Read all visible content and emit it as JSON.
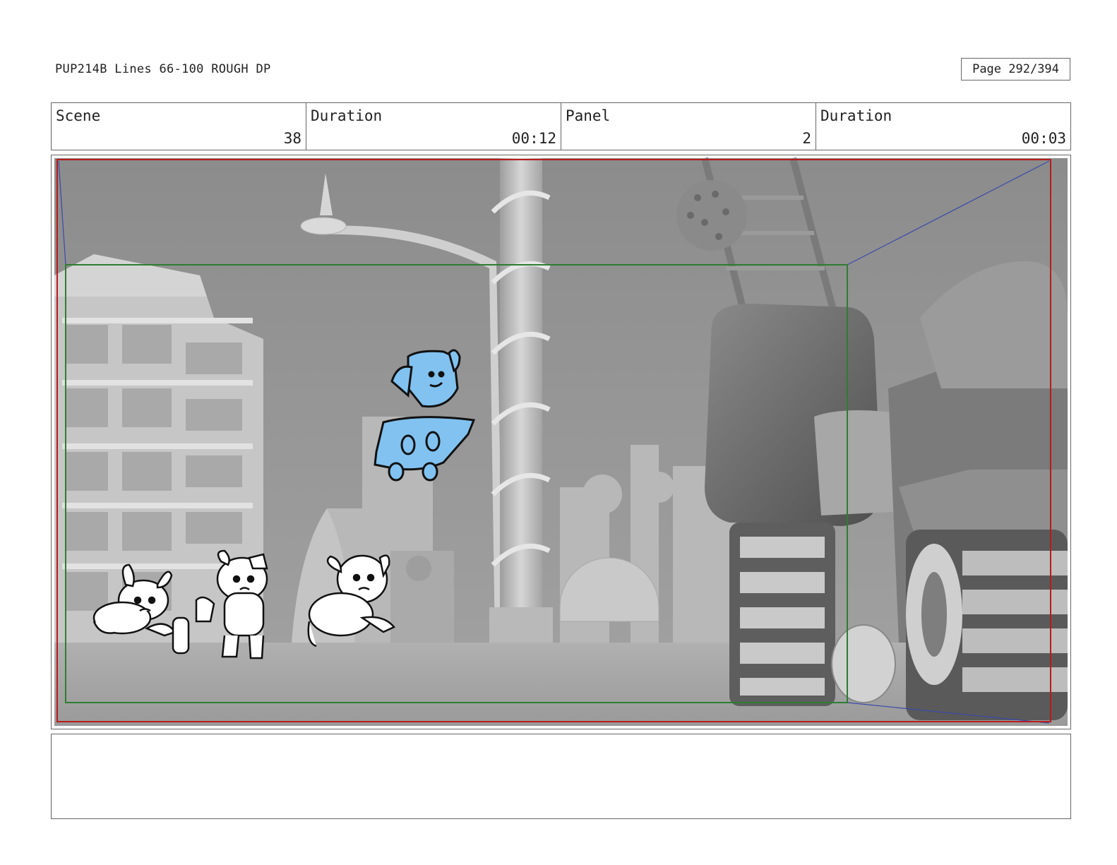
{
  "header": {
    "doc_title": "PUP214B Lines 66-100 ROUGH DP",
    "page_label": "Page 292/394"
  },
  "info": {
    "scene_label": "Scene",
    "scene_value": "38",
    "scene_duration_label": "Duration",
    "scene_duration_value": "00:12",
    "panel_label": "Panel",
    "panel_value": "2",
    "panel_duration_label": "Duration",
    "panel_duration_value": "00:03"
  },
  "panel": {
    "colors": {
      "sky": "#8f8f8f",
      "ground": "#a3a3a3",
      "building": "#bdbdbd",
      "machine": "#6d6d6d",
      "safe_frame": "#2e7d32",
      "outer_frame": "#b71c1c",
      "camera_line": "#3949ab",
      "hero_fill": "#81c2f0"
    }
  },
  "notes": {
    "text": ""
  }
}
